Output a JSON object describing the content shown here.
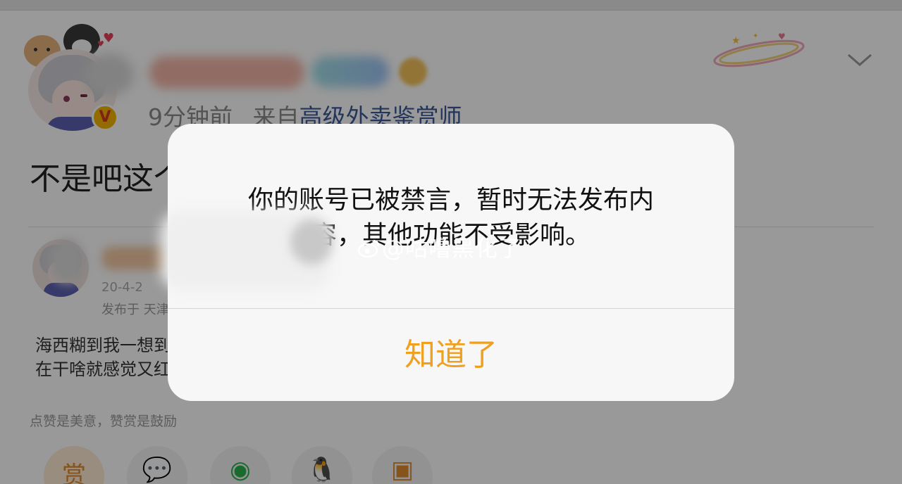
{
  "post": {
    "meta_time": "9分钟前",
    "meta_from": "来自",
    "meta_source": "高级外卖鉴赏师",
    "text": "不是吧这个"
  },
  "comment": {
    "time": "20-4-2",
    "location": "发布于 天津",
    "line1": "海西糊到我一想到",
    "line2": "在干啥就感觉又红"
  },
  "reward_hint": "点赞是美意，赞赏是鼓励",
  "share_buttons": [
    {
      "icon": "reward-icon",
      "glyph": "赏"
    },
    {
      "icon": "wechat-icon",
      "glyph": "💬"
    },
    {
      "icon": "moments-icon",
      "glyph": "◉"
    },
    {
      "icon": "qq-icon",
      "glyph": "🐧"
    },
    {
      "icon": "image-icon",
      "glyph": "▣"
    }
  ],
  "dialog": {
    "message_line1": "你的账号已被禁言，暂时无法发布内",
    "message_line2": "容，其他功能不受影响。",
    "button_label": "知道了"
  },
  "watermark": "@咕噜黑化了",
  "colors": {
    "accent": "#f0a020",
    "link": "#3b5998",
    "vip": "#f4b400"
  }
}
